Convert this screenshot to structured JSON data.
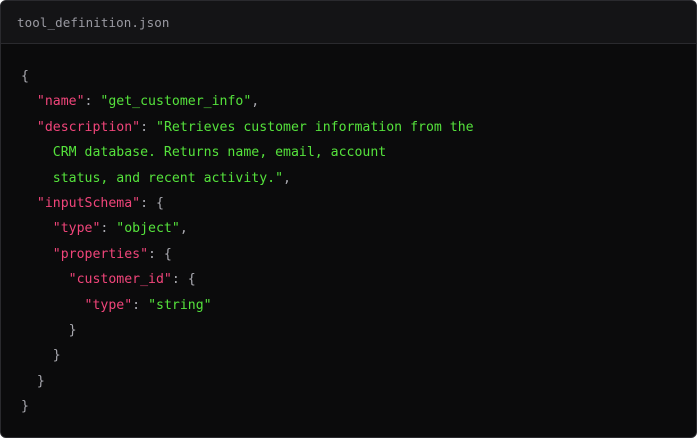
{
  "header": {
    "filename": "tool_definition.json"
  },
  "code": {
    "lines": [
      {
        "indent": 0,
        "parts": [
          {
            "t": "punc",
            "v": "{"
          }
        ]
      },
      {
        "indent": 2,
        "parts": [
          {
            "t": "key",
            "v": "\"name\""
          },
          {
            "t": "punc",
            "v": ": "
          },
          {
            "t": "str",
            "v": "\"get_customer_info\""
          },
          {
            "t": "punc",
            "v": ","
          }
        ]
      },
      {
        "indent": 2,
        "parts": [
          {
            "t": "key",
            "v": "\"description\""
          },
          {
            "t": "punc",
            "v": ": "
          },
          {
            "t": "str",
            "v": "\"Retrieves customer information from the"
          }
        ]
      },
      {
        "indent": 4,
        "parts": [
          {
            "t": "str",
            "v": "CRM database. Returns name, email, account"
          }
        ]
      },
      {
        "indent": 4,
        "parts": [
          {
            "t": "str",
            "v": "status, and recent activity.\""
          },
          {
            "t": "punc",
            "v": ","
          }
        ]
      },
      {
        "indent": 2,
        "parts": [
          {
            "t": "key",
            "v": "\"inputSchema\""
          },
          {
            "t": "punc",
            "v": ": {"
          }
        ]
      },
      {
        "indent": 4,
        "parts": [
          {
            "t": "key",
            "v": "\"type\""
          },
          {
            "t": "punc",
            "v": ": "
          },
          {
            "t": "str",
            "v": "\"object\""
          },
          {
            "t": "punc",
            "v": ","
          }
        ]
      },
      {
        "indent": 4,
        "parts": [
          {
            "t": "key",
            "v": "\"properties\""
          },
          {
            "t": "punc",
            "v": ": {"
          }
        ]
      },
      {
        "indent": 6,
        "parts": [
          {
            "t": "key",
            "v": "\"customer_id\""
          },
          {
            "t": "punc",
            "v": ": {"
          }
        ]
      },
      {
        "indent": 8,
        "parts": [
          {
            "t": "key",
            "v": "\"type\""
          },
          {
            "t": "punc",
            "v": ": "
          },
          {
            "t": "str",
            "v": "\"string\""
          }
        ]
      },
      {
        "indent": 6,
        "parts": [
          {
            "t": "punc",
            "v": "}"
          }
        ]
      },
      {
        "indent": 4,
        "parts": [
          {
            "t": "punc",
            "v": "}"
          }
        ]
      },
      {
        "indent": 2,
        "parts": [
          {
            "t": "punc",
            "v": "}"
          }
        ]
      },
      {
        "indent": 0,
        "parts": [
          {
            "t": "punc",
            "v": "}"
          }
        ]
      }
    ]
  },
  "colors": {
    "background": "#0b0b0c",
    "header_background": "#141416",
    "key": "#f0457a",
    "string": "#55e23c",
    "punctuation": "#a9a9b0",
    "filename": "#9a9aa2"
  }
}
